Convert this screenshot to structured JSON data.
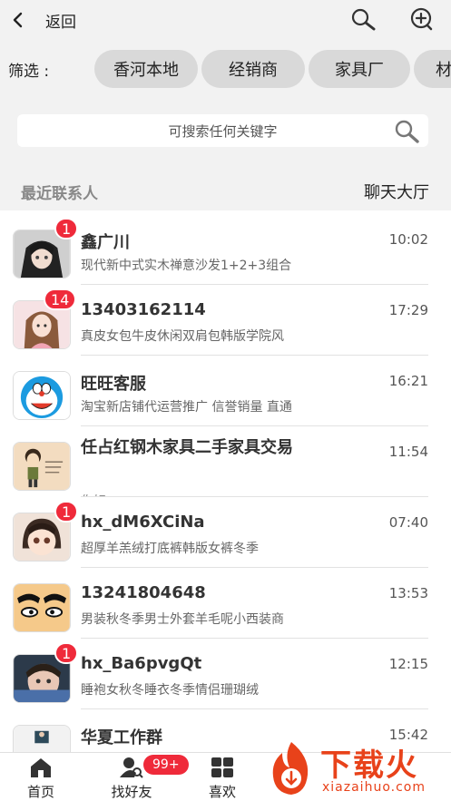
{
  "nav": {
    "back_label": "返回",
    "back_icon": "chevron-left-icon",
    "search_icon": "search-icon",
    "add_icon": "add-circle-icon"
  },
  "filter": {
    "label": "筛选 :",
    "chips": [
      "香河本地",
      "经销商",
      "家具厂",
      "材"
    ]
  },
  "search": {
    "placeholder": "可搜索任何关键字",
    "icon": "search-icon"
  },
  "section": {
    "recent": "最近联系人",
    "lobby": "聊天大厅"
  },
  "contacts": [
    {
      "name": "鑫广川",
      "message": "现代新中式实木禅意沙发1+2+3组合",
      "time": "10:02",
      "badge": "1",
      "avatar": "anime-boy-avatar"
    },
    {
      "name": "13403162114",
      "message": "真皮女包牛皮休闲双肩包韩版学院风",
      "time": "17:29",
      "badge": "14",
      "avatar": "girl-avatar"
    },
    {
      "name": "旺旺客服",
      "message": "淘宝新店铺代运营推广 信誉销量 直通",
      "time": "16:21",
      "badge": "",
      "avatar": "doraemon-avatar"
    },
    {
      "name": "任占红钢木家具二手家具交易",
      "message": "你好",
      "time": "11:54",
      "badge": "",
      "avatar": "cartoon-boy-avatar"
    },
    {
      "name": "hx_dM6XCiNa",
      "message": "超厚羊羔绒打底裤韩版女裤冬季",
      "time": "07:40",
      "badge": "1",
      "avatar": "anime-chibi-avatar"
    },
    {
      "name": "13241804648",
      "message": "男装秋冬季男士外套羊毛呢小西装商",
      "time": "13:53",
      "badge": "",
      "avatar": "eyebrows-avatar"
    },
    {
      "name": "hx_Ba6pvgQt",
      "message": "睡袍女秋冬睡衣冬季情侣珊瑚绒",
      "time": "12:15",
      "badge": "1",
      "avatar": "baby-photo-avatar"
    },
    {
      "name": "华夏工作群",
      "message": "",
      "time": "15:42",
      "badge": "",
      "avatar": "group-avatar"
    }
  ],
  "tabs": [
    {
      "label": "首页",
      "icon": "home-icon"
    },
    {
      "label": "找好友",
      "icon": "find-friends-icon",
      "badge": "99+"
    },
    {
      "label": "喜欢",
      "icon": "grid-icon"
    }
  ],
  "watermark": {
    "text": "下载火",
    "sub": "xiazaihuo.com"
  },
  "colors": {
    "badge": "#ef2a3a",
    "background_gray": "#f2f2f2",
    "watermark": "#e8421a"
  }
}
